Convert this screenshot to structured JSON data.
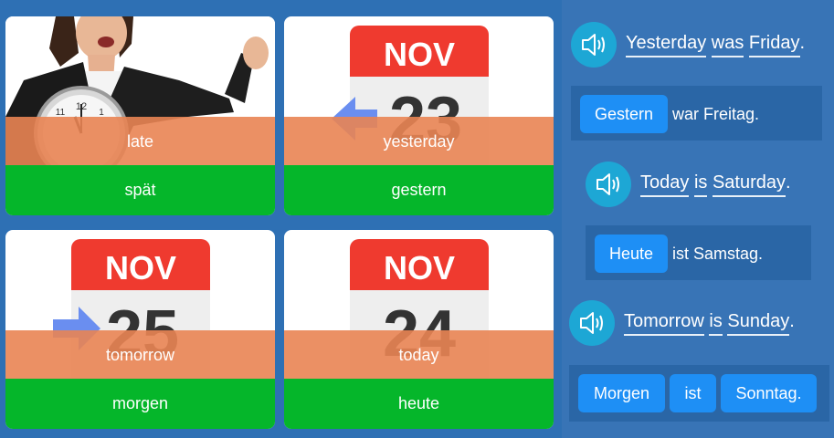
{
  "cards": [
    {
      "word": "late",
      "translation": "spät"
    },
    {
      "word": "yesterday",
      "translation": "gestern",
      "calendar": {
        "month": "NOV",
        "day": "23"
      }
    },
    {
      "word": "tomorrow",
      "translation": "morgen",
      "calendar": {
        "month": "NOV",
        "day": "25"
      }
    },
    {
      "word": "today",
      "translation": "heute",
      "calendar": {
        "month": "NOV",
        "day": "24"
      }
    }
  ],
  "exercises": [
    {
      "sentence": {
        "w1": "Yesterday",
        "w2": "was",
        "w3": "Friday",
        "punct": "."
      },
      "answer": {
        "chip1": "Gestern",
        "rest": "war Freitag."
      }
    },
    {
      "sentence": {
        "w1": "Today",
        "w2": "is",
        "w3": "Saturday",
        "punct": "."
      },
      "answer": {
        "chip1": "Heute",
        "rest": "ist Samstag."
      }
    },
    {
      "sentence": {
        "w1": "Tomorrow",
        "w2": "is",
        "w3": "Sunday",
        "punct": "."
      },
      "answer": {
        "chip1": "Morgen",
        "chip2": "ist",
        "chip3": "Sonntag."
      }
    }
  ],
  "colors": {
    "background": "#2e70b4",
    "card_footer": "#05b62a",
    "word_overlay": "#e98453",
    "calendar_header": "#ef3a2f",
    "speaker": "#1da7d5",
    "chip": "#1e8ff5",
    "arrow": "#6a8ef0"
  },
  "icons": {
    "speaker": "speaker-icon",
    "arrow_left": "arrow-left-icon",
    "arrow_right": "arrow-right-icon"
  }
}
